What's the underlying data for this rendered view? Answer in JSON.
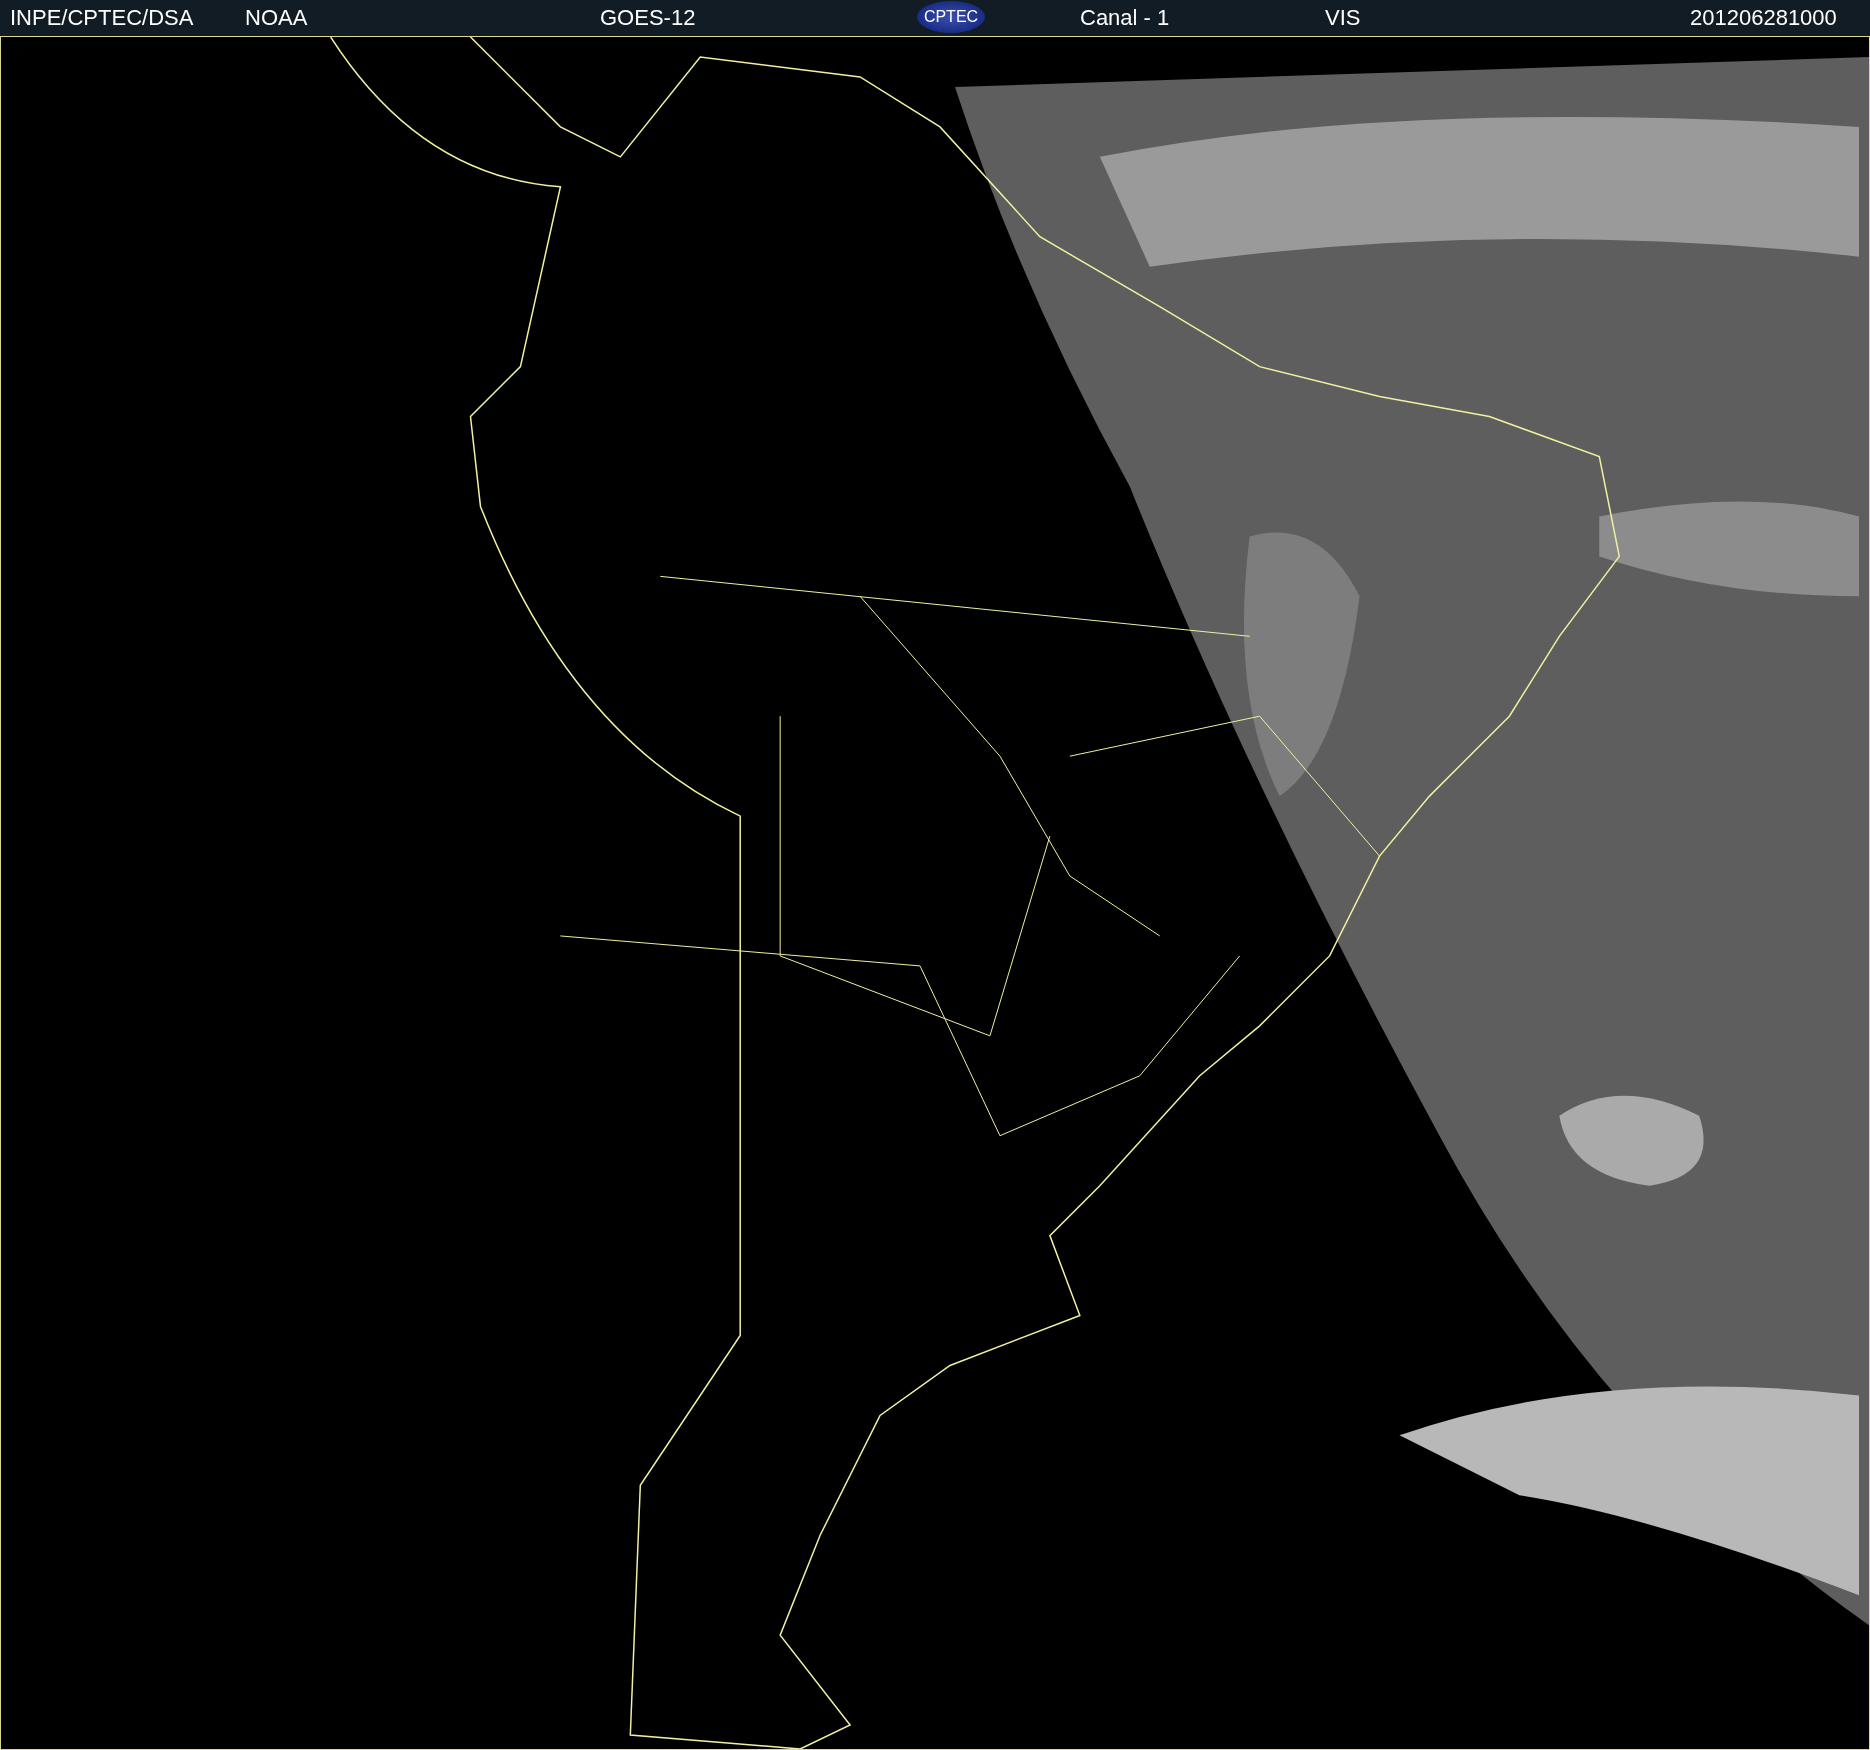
{
  "header": {
    "source": "INPE/CPTEC/DSA",
    "agency": "NOAA",
    "satellite": "GOES-12",
    "logo_text": "CPTEC",
    "channel": "Canal - 1",
    "band": "VIS",
    "timestamp": "201206281000"
  }
}
